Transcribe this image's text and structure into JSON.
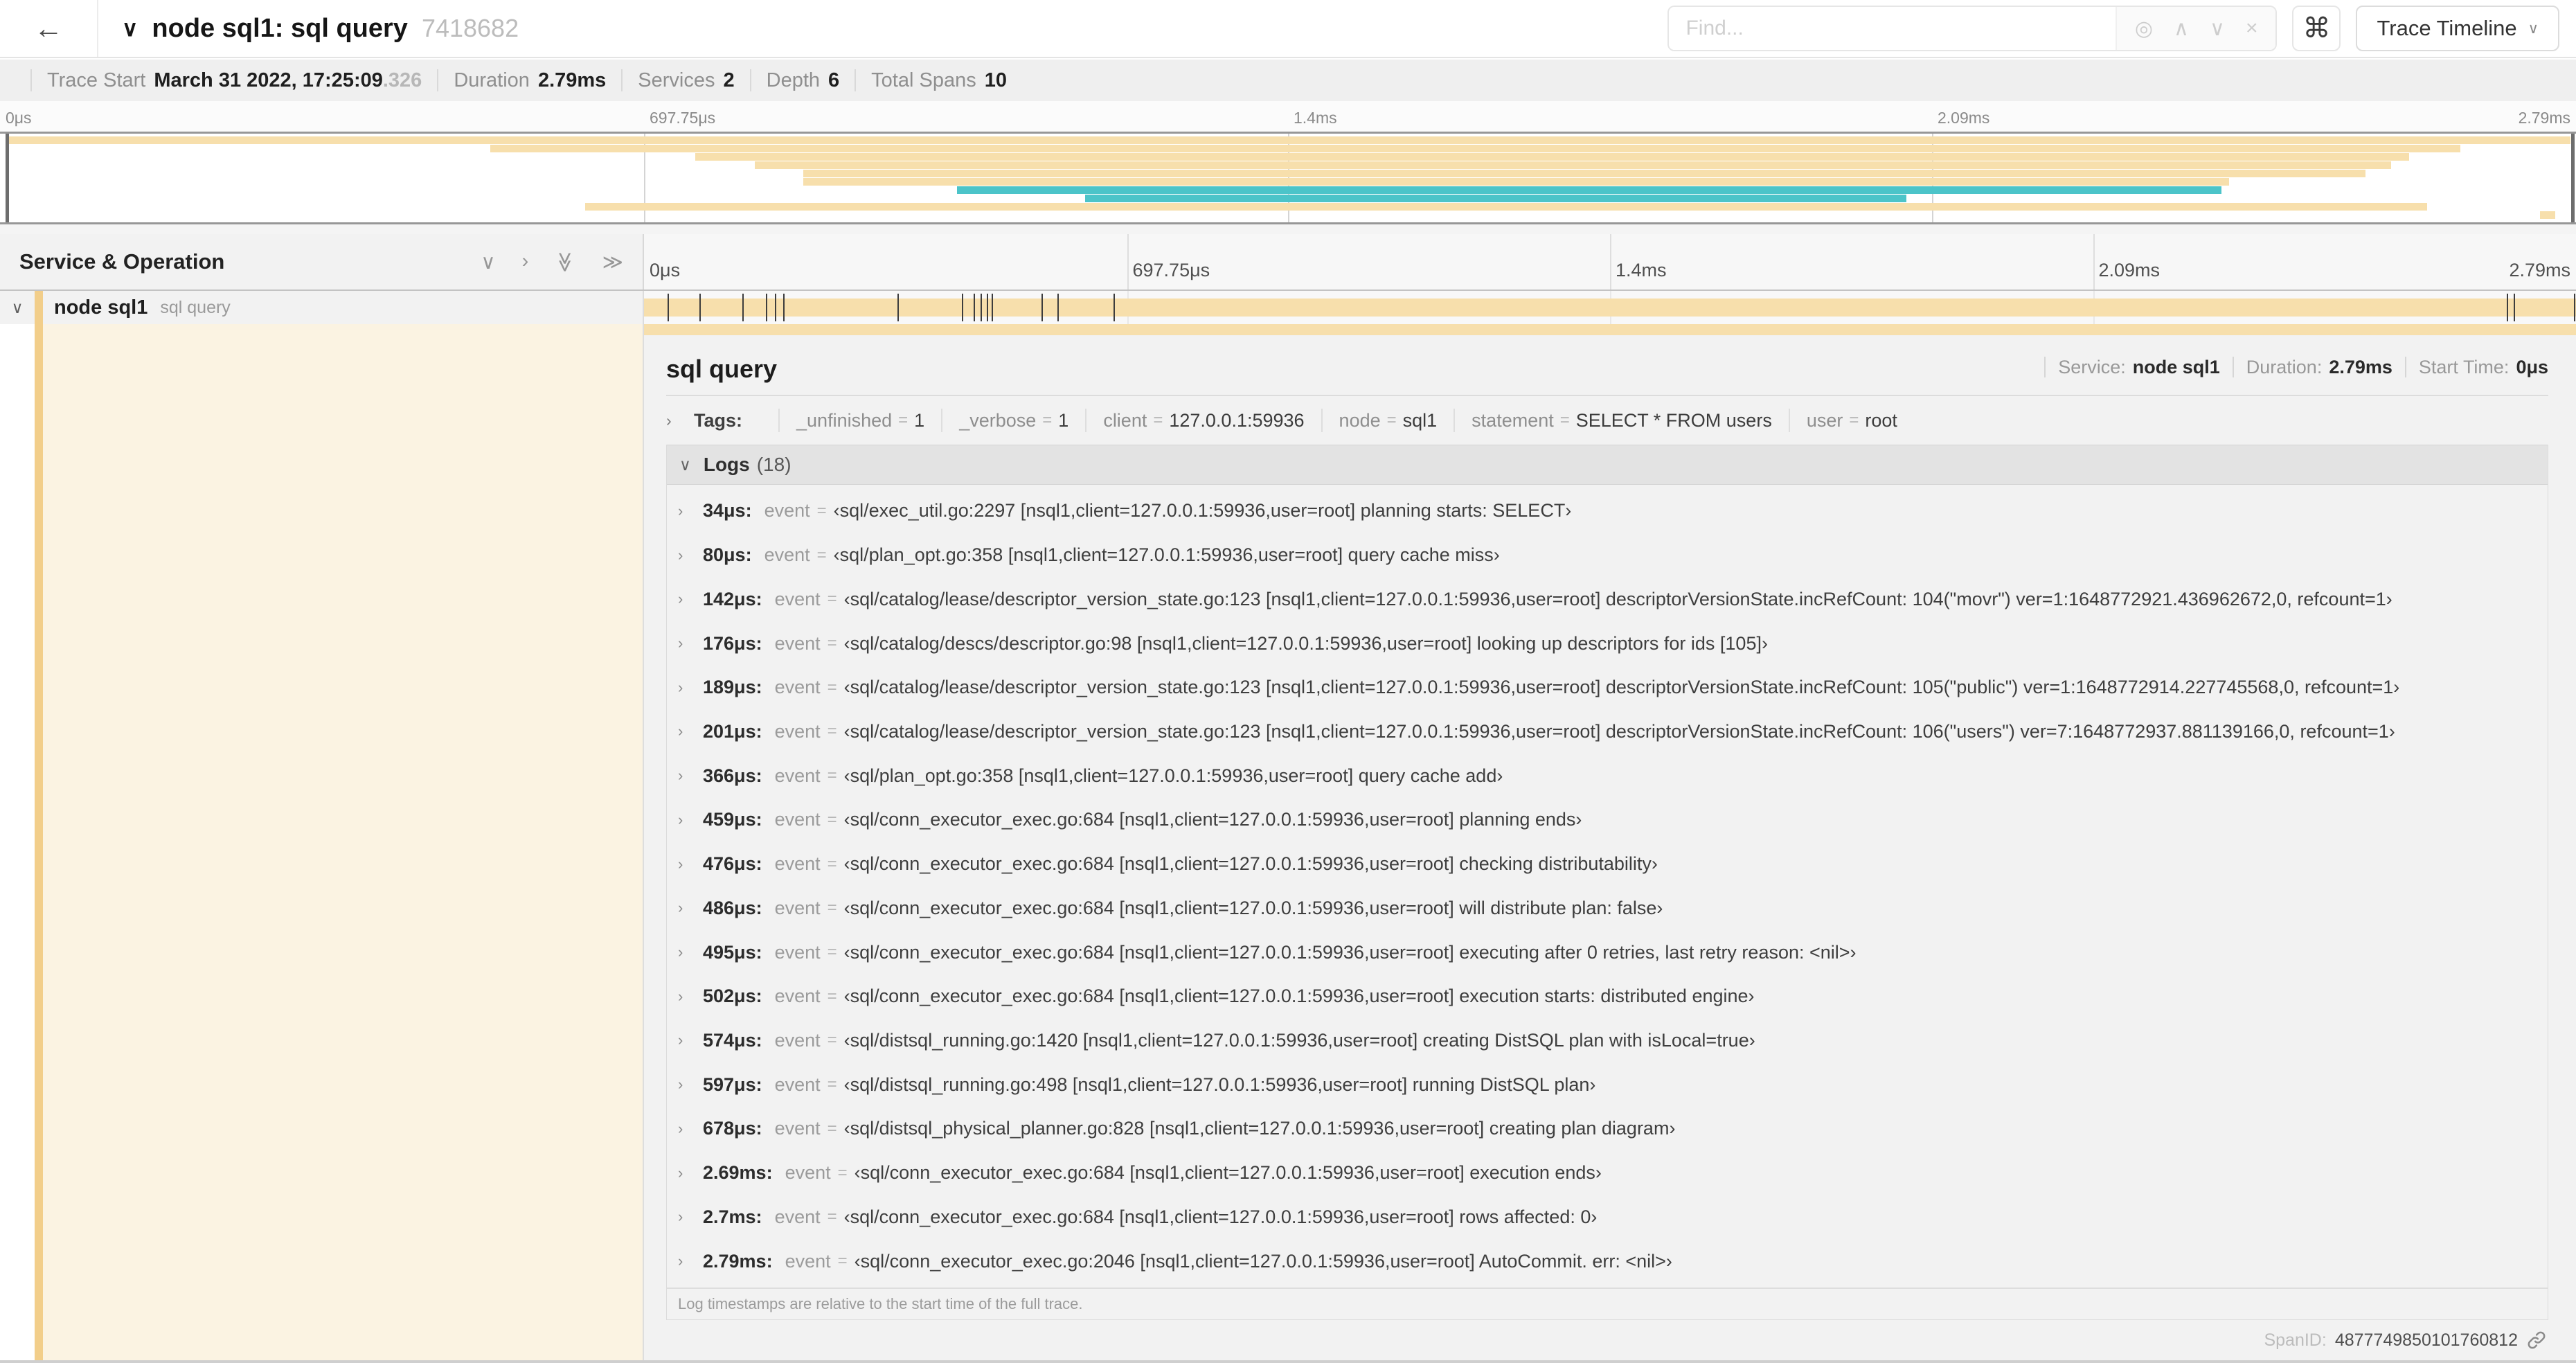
{
  "icons": {
    "back": "←",
    "title_collapse": "∨",
    "locate": "◎",
    "prev": "∧",
    "next": "∨",
    "clear": "×",
    "shortcut": "⌘",
    "dropdown": "∨",
    "collapse_one": "∨",
    "expand_one": "›",
    "collapse_all": "≫",
    "expand_all": "≫",
    "row_collapse": "∨",
    "chevron_right": "›",
    "logs_collapse": "∨"
  },
  "misc": {
    "eq": "="
  },
  "header": {
    "title": "node sql1: sql query",
    "trace_id": "7418682",
    "find_placeholder": "Find...",
    "view_button": "Trace Timeline"
  },
  "summary": {
    "items": [
      {
        "label": "Trace Start",
        "value": "March 31 2022, 17:25:09",
        "suffix": ".326"
      },
      {
        "label": "Duration",
        "value": "2.79ms",
        "suffix": ""
      },
      {
        "label": "Services",
        "value": "2",
        "suffix": ""
      },
      {
        "label": "Depth",
        "value": "6",
        "suffix": ""
      },
      {
        "label": "Total Spans",
        "value": "10",
        "suffix": ""
      }
    ]
  },
  "timeline": {
    "left_header": "Service & Operation",
    "ticks": [
      "0μs",
      "697.75μs",
      "1.4ms",
      "2.09ms",
      "2.79ms"
    ],
    "colors": {
      "tan": "#F7DFAC",
      "teal": "#4CC4C9",
      "accent": "#F2CE8A",
      "cream": "#FBF3E2"
    },
    "minimap_spans": [
      {
        "s": 0,
        "e": 100,
        "c": "tan"
      },
      {
        "s": 18.9,
        "e": 95.7,
        "c": "tan"
      },
      {
        "s": 26.9,
        "e": 93.7,
        "c": "tan"
      },
      {
        "s": 29.2,
        "e": 93.0,
        "c": "tan"
      },
      {
        "s": 31.1,
        "e": 92.0,
        "c": "tan"
      },
      {
        "s": 31.1,
        "e": 86.7,
        "c": "tan"
      },
      {
        "s": 37.1,
        "e": 86.4,
        "c": "teal"
      },
      {
        "s": 42.1,
        "e": 74.1,
        "c": "teal"
      },
      {
        "s": 22.6,
        "e": 94.4,
        "c": "tan"
      },
      {
        "s": 98.8,
        "e": 99.4,
        "c": "tan"
      }
    ],
    "row": {
      "service": "node sql1",
      "operation": "sql query"
    },
    "marker_pct": [
      1.22,
      2.87,
      5.09,
      6.31,
      6.77,
      7.2,
      13.12,
      16.45,
      17.06,
      17.42,
      17.74,
      17.99,
      20.57,
      21.4,
      24.3,
      96.42,
      96.77,
      99.9
    ]
  },
  "detail": {
    "title": "sql query",
    "meta": [
      {
        "label": "Service:",
        "value": "node sql1"
      },
      {
        "label": "Duration:",
        "value": "2.79ms"
      },
      {
        "label": "Start Time:",
        "value": "0μs"
      }
    ],
    "tags_label": "Tags:",
    "tags": [
      {
        "key": "_unfinished",
        "value": "1"
      },
      {
        "key": "_verbose",
        "value": "1"
      },
      {
        "key": "client",
        "value": "127.0.0.1:59936"
      },
      {
        "key": "node",
        "value": "sql1"
      },
      {
        "key": "statement",
        "value": "SELECT * FROM users"
      },
      {
        "key": "user",
        "value": "root"
      }
    ],
    "logs_title": "Logs",
    "logs_count": "(18)",
    "logs": [
      {
        "t": "34μs:",
        "f": "event",
        "v": "‹sql/exec_util.go:2297 [nsql1,client=127.0.0.1:59936,user=root] planning starts: SELECT›"
      },
      {
        "t": "80μs:",
        "f": "event",
        "v": "‹sql/plan_opt.go:358 [nsql1,client=127.0.0.1:59936,user=root] query cache miss›"
      },
      {
        "t": "142μs:",
        "f": "event",
        "v": "‹sql/catalog/lease/descriptor_version_state.go:123 [nsql1,client=127.0.0.1:59936,user=root] descriptorVersionState.incRefCount: 104(\"movr\") ver=1:1648772921.436962672,0, refcount=1›"
      },
      {
        "t": "176μs:",
        "f": "event",
        "v": "‹sql/catalog/descs/descriptor.go:98 [nsql1,client=127.0.0.1:59936,user=root] looking up descriptors for ids [105]›"
      },
      {
        "t": "189μs:",
        "f": "event",
        "v": "‹sql/catalog/lease/descriptor_version_state.go:123 [nsql1,client=127.0.0.1:59936,user=root] descriptorVersionState.incRefCount: 105(\"public\") ver=1:1648772914.227745568,0, refcount=1›"
      },
      {
        "t": "201μs:",
        "f": "event",
        "v": "‹sql/catalog/lease/descriptor_version_state.go:123 [nsql1,client=127.0.0.1:59936,user=root] descriptorVersionState.incRefCount: 106(\"users\") ver=7:1648772937.881139166,0, refcount=1›"
      },
      {
        "t": "366μs:",
        "f": "event",
        "v": "‹sql/plan_opt.go:358 [nsql1,client=127.0.0.1:59936,user=root] query cache add›"
      },
      {
        "t": "459μs:",
        "f": "event",
        "v": "‹sql/conn_executor_exec.go:684 [nsql1,client=127.0.0.1:59936,user=root] planning ends›"
      },
      {
        "t": "476μs:",
        "f": "event",
        "v": "‹sql/conn_executor_exec.go:684 [nsql1,client=127.0.0.1:59936,user=root] checking distributability›"
      },
      {
        "t": "486μs:",
        "f": "event",
        "v": "‹sql/conn_executor_exec.go:684 [nsql1,client=127.0.0.1:59936,user=root] will distribute plan: false›"
      },
      {
        "t": "495μs:",
        "f": "event",
        "v": "‹sql/conn_executor_exec.go:684 [nsql1,client=127.0.0.1:59936,user=root] executing after 0 retries, last retry reason: <nil>›"
      },
      {
        "t": "502μs:",
        "f": "event",
        "v": "‹sql/conn_executor_exec.go:684 [nsql1,client=127.0.0.1:59936,user=root] execution starts: distributed engine›"
      },
      {
        "t": "574μs:",
        "f": "event",
        "v": "‹sql/distsql_running.go:1420 [nsql1,client=127.0.0.1:59936,user=root] creating DistSQL plan with isLocal=true›"
      },
      {
        "t": "597μs:",
        "f": "event",
        "v": "‹sql/distsql_running.go:498 [nsql1,client=127.0.0.1:59936,user=root] running DistSQL plan›"
      },
      {
        "t": "678μs:",
        "f": "event",
        "v": "‹sql/distsql_physical_planner.go:828 [nsql1,client=127.0.0.1:59936,user=root] creating plan diagram›"
      },
      {
        "t": "2.69ms:",
        "f": "event",
        "v": "‹sql/conn_executor_exec.go:684 [nsql1,client=127.0.0.1:59936,user=root] execution ends›"
      },
      {
        "t": "2.7ms:",
        "f": "event",
        "v": "‹sql/conn_executor_exec.go:684 [nsql1,client=127.0.0.1:59936,user=root] rows affected: 0›"
      },
      {
        "t": "2.79ms:",
        "f": "event",
        "v": "‹sql/conn_executor_exec.go:2046 [nsql1,client=127.0.0.1:59936,user=root] AutoCommit. err: <nil>›"
      }
    ],
    "logs_note": "Log timestamps are relative to the start time of the full trace.",
    "span_id_label": "SpanID:",
    "span_id": "4877749850101760812"
  }
}
